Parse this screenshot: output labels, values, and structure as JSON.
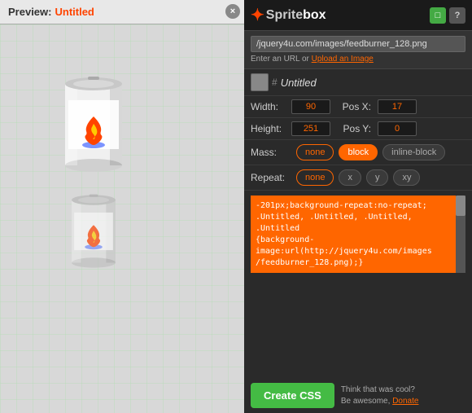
{
  "preview": {
    "label": "Preview:",
    "title": "Untitled",
    "close_icon": "×"
  },
  "spritebox": {
    "logo_icon": "✦",
    "logo_sprite": "Sprite",
    "logo_box": "box",
    "header_btn1": "□",
    "header_btn2": "?"
  },
  "url_bar": {
    "value": "/jquery4u.com/images/feedburner_128.png",
    "hint_text": "Enter an URL or",
    "upload_label": "Upload an Image"
  },
  "name_field": {
    "hash": "#",
    "value": "Untitled"
  },
  "dimensions": {
    "width_label": "Width:",
    "width_value": "90",
    "posx_label": "Pos X:",
    "posx_value": "17",
    "height_label": "Height:",
    "height_value": "251",
    "posy_label": "Pos Y:",
    "posy_value": "0"
  },
  "mass": {
    "label": "Mass:",
    "options": [
      "none",
      "block",
      "inline-block"
    ]
  },
  "repeat": {
    "label": "Repeat:",
    "options": [
      "none",
      "x",
      "y",
      "xy"
    ]
  },
  "css_output": {
    "content": "-201px;background-repeat:no-repeat;\n.Untitled, .Untitled, .Untitled, .Untitled\n{background-\nimage:url(http://jquery4u.com/images\n/feedburner_128.png);}"
  },
  "create_btn": {
    "label": "Create CSS"
  },
  "donate": {
    "prefix": "Think that was cool?",
    "middle": "Be awesome,",
    "link": "Donate"
  }
}
